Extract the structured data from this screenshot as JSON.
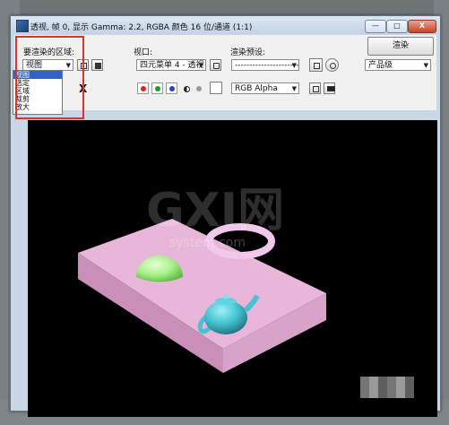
{
  "window": {
    "title": "透视, 帧 0, 显示 Gamma: 2.2, RGBA 颜色 16 位/通道 (1:1)",
    "buttons": {
      "minimize": "—",
      "restore": "□",
      "close": "X"
    }
  },
  "toolbar": {
    "area_label": "要渲染的区域:",
    "area_value": "视图",
    "viewport_label": "视口:",
    "viewport_value": "四元菜单 4 - 透视",
    "preset_label": "渲染预设:",
    "preset_value": "-------------------------",
    "render_button": "渲染",
    "quality_value": "产品级",
    "channel_value": "RGB Alpha",
    "clear_icon": "X"
  },
  "area_options": [
    "视图",
    "选定",
    "区域",
    "裁剪",
    "放大"
  ],
  "area_options_selected_index": 0,
  "colors": {
    "highlight_box": "#e0302c",
    "channel_red": "#d22626",
    "channel_green": "#1b9a2a",
    "channel_blue": "#2a3fd0",
    "plane": "#e7b6d9",
    "hemisphere": "#a9f08a",
    "teapot": "#46c3d2",
    "torus": "#efc8ea"
  },
  "viewport_scene": {
    "watermark_main": "GXI网",
    "watermark_sub": "system.com"
  }
}
